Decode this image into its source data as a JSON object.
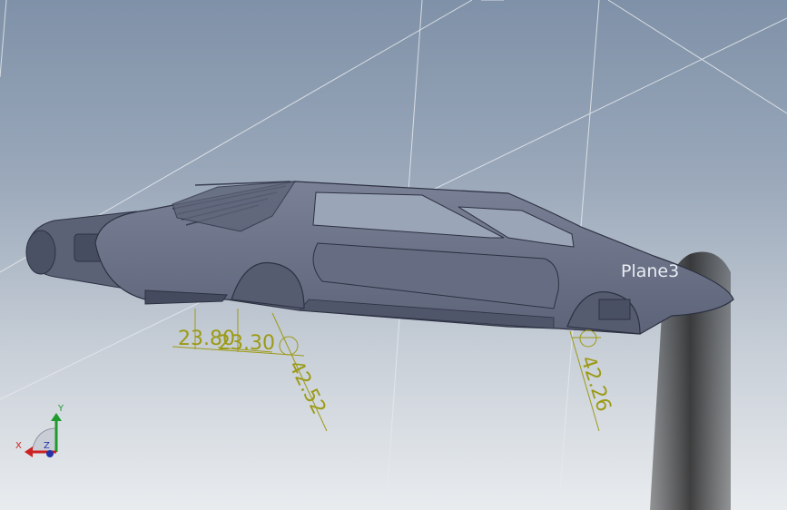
{
  "viewport": {
    "plane_label": "Plane3",
    "dimensions": [
      {
        "id": "dim-1",
        "value": "23.80"
      },
      {
        "id": "dim-2",
        "value": "23.30"
      },
      {
        "id": "dim-3",
        "value": "42.52"
      },
      {
        "id": "dim-4",
        "value": "42.26"
      }
    ],
    "triad": {
      "x": "X",
      "y": "Y",
      "z": "Z"
    }
  },
  "colors": {
    "background_top": "#7f91a8",
    "background_bottom": "#e9ecef",
    "body_fill": "#6b7287",
    "dimension_color": "#9c9a16",
    "plane_line": "#e6e9ee"
  }
}
